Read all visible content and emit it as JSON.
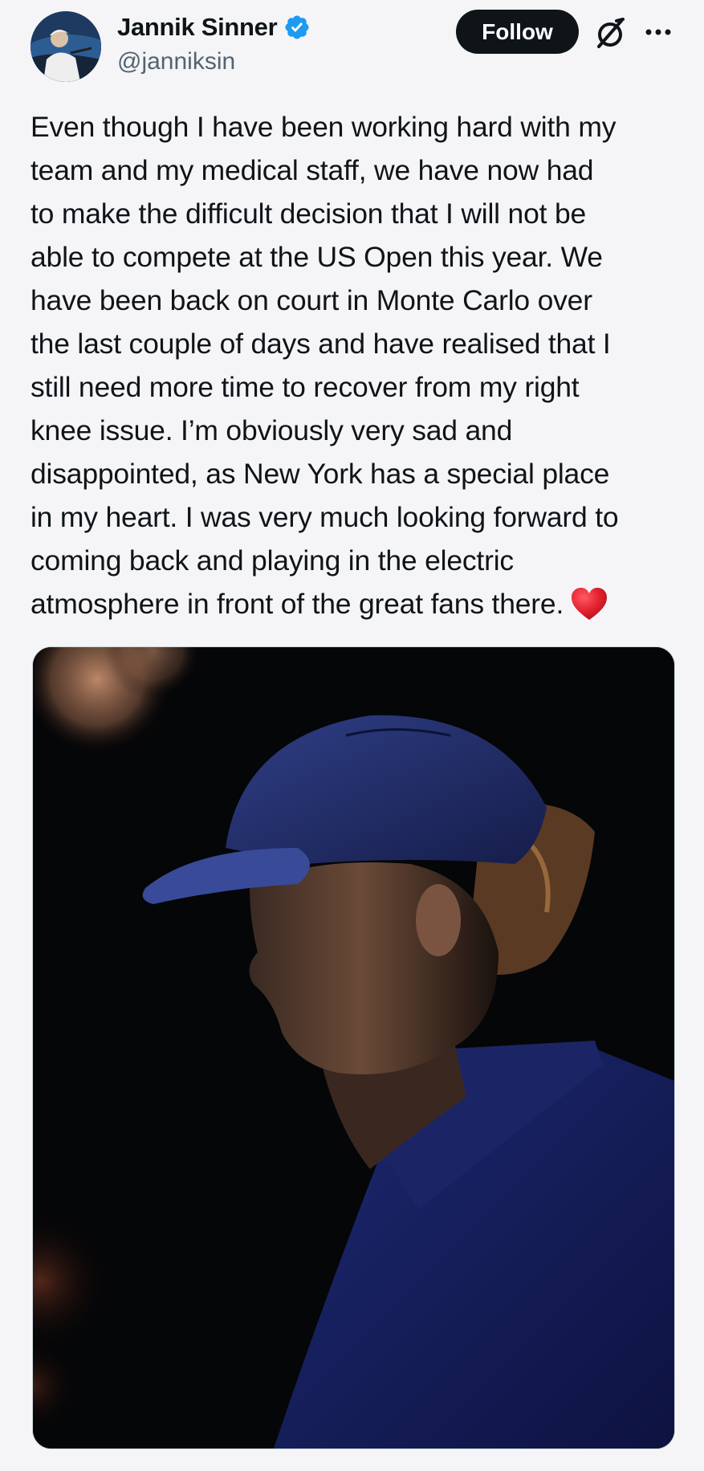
{
  "author": {
    "display_name": "Jannik Sinner",
    "handle": "@janniksin",
    "verified": true,
    "avatar_icon": "avatar-photo"
  },
  "actions": {
    "follow_label": "Follow",
    "grok_icon": "grok-icon",
    "more_icon": "more-options-icon"
  },
  "tweet": {
    "text": "Even though I have been working hard with my\nteam and my medical staff, we have now had\nto make the difficult decision that I will not be\nable to compete at the US Open this year. We\nhave been back on court in Monte Carlo over\nthe last couple of days and have realised that I\nstill need more time to recover from my right\nknee issue. I’m obviously very sad and\ndisappointed, as New York has a special place\nin my heart. I was very much looking forward to\ncoming back and playing in the electric\natmosphere in front of the great fans there.",
    "emoji": "red-heart"
  },
  "media": {
    "type": "photo"
  },
  "colors": {
    "background": "#f5f5f7",
    "text": "#0f1419",
    "secondary_text": "#536471",
    "verified_blue": "#1d9bf0",
    "follow_button": "#0f1419",
    "heart_red": "#e0202e"
  }
}
